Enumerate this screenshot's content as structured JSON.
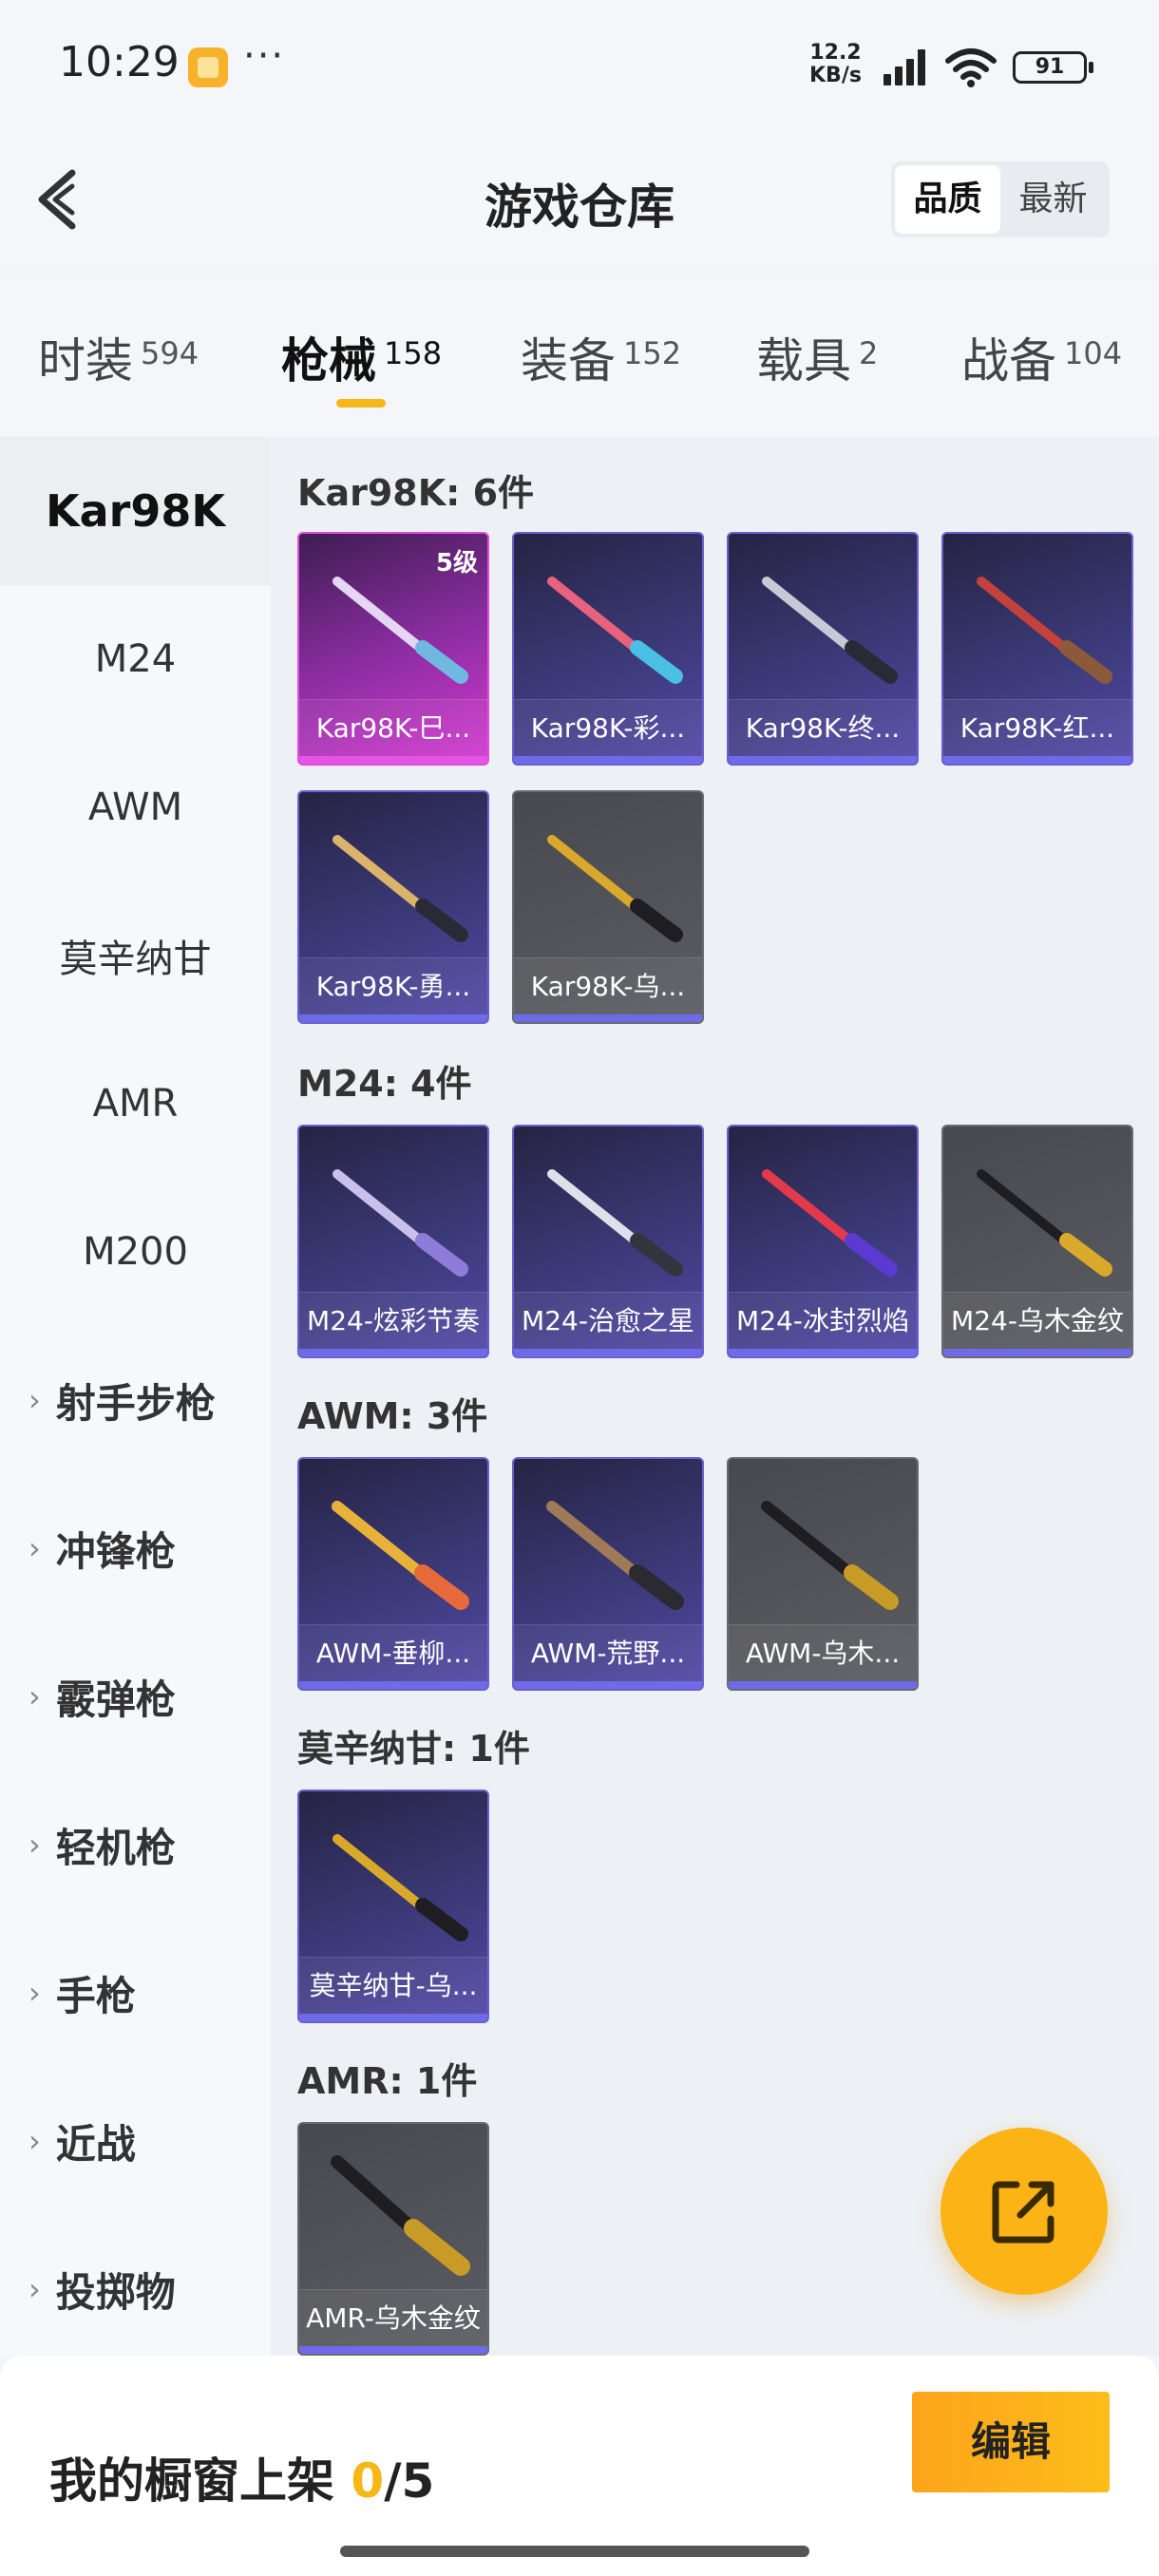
{
  "status": {
    "time": "10:29",
    "speed_top": "12.2",
    "speed_bottom": "KB/s",
    "battery": "91"
  },
  "header": {
    "title": "游戏仓库",
    "sort_quality": "品质",
    "sort_newest": "最新"
  },
  "tabs": [
    {
      "label": "时装",
      "count": "594"
    },
    {
      "label": "枪械",
      "count": "158"
    },
    {
      "label": "装备",
      "count": "152"
    },
    {
      "label": "载具",
      "count": "2"
    },
    {
      "label": "战备",
      "count": "104"
    }
  ],
  "sidebar": {
    "models": [
      "Kar98K",
      "M24",
      "AWM",
      "莫辛纳甘",
      "AMR",
      "M200"
    ],
    "categories": [
      "射手步枪",
      "冲锋枪",
      "霰弹枪",
      "轻机枪",
      "手枪",
      "近战",
      "投掷物"
    ]
  },
  "sections": [
    {
      "title": "Kar98K: 6件",
      "items": [
        "Kar98K-巳...",
        "Kar98K-彩...",
        "Kar98K-终...",
        "Kar98K-红...",
        "Kar98K-勇...",
        "Kar98K-乌..."
      ],
      "level_badge": "5级"
    },
    {
      "title": "M24: 4件",
      "items": [
        "M24-炫彩节奏",
        "M24-治愈之星",
        "M24-冰封烈焰",
        "M24-乌木金纹"
      ]
    },
    {
      "title": "AWM: 3件",
      "items": [
        "AWM-垂柳...",
        "AWM-荒野...",
        "AWM-乌木..."
      ]
    },
    {
      "title": "莫辛纳甘: 1件",
      "items": [
        "莫辛纳甘-乌..."
      ]
    },
    {
      "title": "AMR: 1件",
      "items": [
        "AMR-乌木金纹"
      ]
    }
  ],
  "bottom": {
    "label": "我的橱窗上架",
    "current": "0",
    "total": "/5",
    "edit": "编辑"
  },
  "colors": {
    "accent": "#f7b718",
    "purple_card": "#3b3a78",
    "gray_card": "#5c5d62",
    "pink_card": "#d43ad0"
  }
}
